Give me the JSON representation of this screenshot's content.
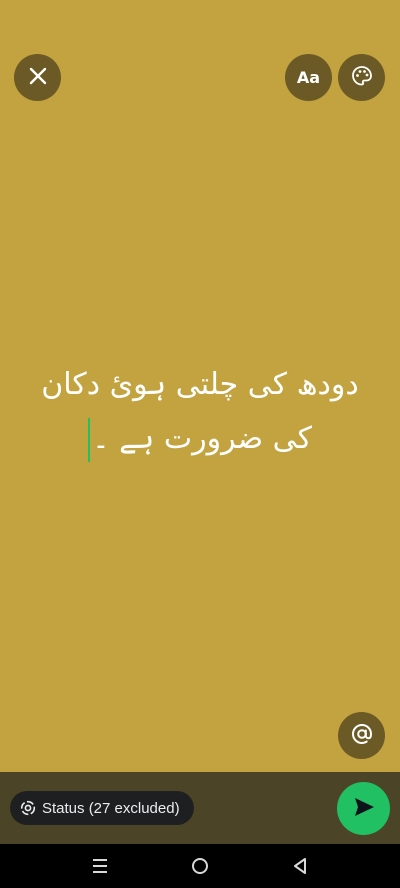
{
  "toolbar": {
    "font_label": "Aa"
  },
  "status": {
    "line1": "دودھ کی چلتی ہوئ دکان",
    "line2": "کی ضرورت ہے ۔"
  },
  "bottom": {
    "audience_label": "Status (27 excluded)"
  },
  "colors": {
    "background": "#c3a340",
    "accent": "#21c063"
  },
  "icons": {
    "close": "close-icon",
    "palette": "palette-icon",
    "mention": "at-sign-icon",
    "status_ring": "status-ring-icon",
    "send": "send-icon"
  }
}
